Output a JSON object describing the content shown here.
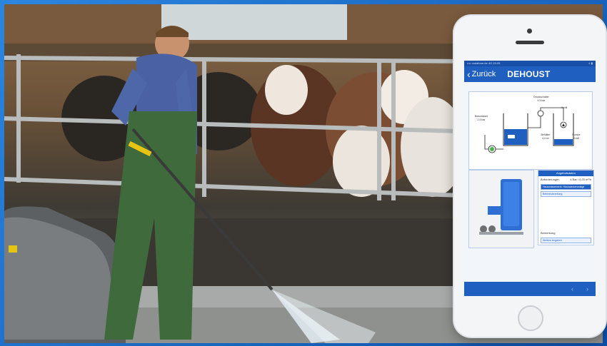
{
  "scene": {
    "description_colors": {
      "frame": "#1a6fc9",
      "app_blue": "#1f5fbf"
    }
  },
  "phone": {
    "statusbar": {
      "carrier": "•••• vodafone.de  4G 15:33",
      "battery": "⋄ ▮"
    },
    "navbar": {
      "back_label": "Zurück",
      "brand": "DEHOUST"
    },
    "diagram": {
      "labels": {
        "inlet": "Brauwasser",
        "inlet_sub": "2,5 bar",
        "pressure": "Druckschalter",
        "pressure_sub": "4,5 bar",
        "tank": "Behälter",
        "tank_sub": "4,0 m³",
        "valve": "Ventil",
        "pump": "Pumpe",
        "pump_sub": "4 kW"
      }
    },
    "form": {
      "header": "Angebotsdaten",
      "row1_label": "Anforderungen",
      "row1_value": "4 Bar / 0.25 m³/h",
      "field1": "Hauswasserwerk: Hauswasseranlage",
      "field2": "Betriebsbereitung",
      "row2_label": "Bemerkung",
      "field3": "Weitere Angaben"
    },
    "bottom": {
      "prev": "‹",
      "next": "›"
    }
  }
}
